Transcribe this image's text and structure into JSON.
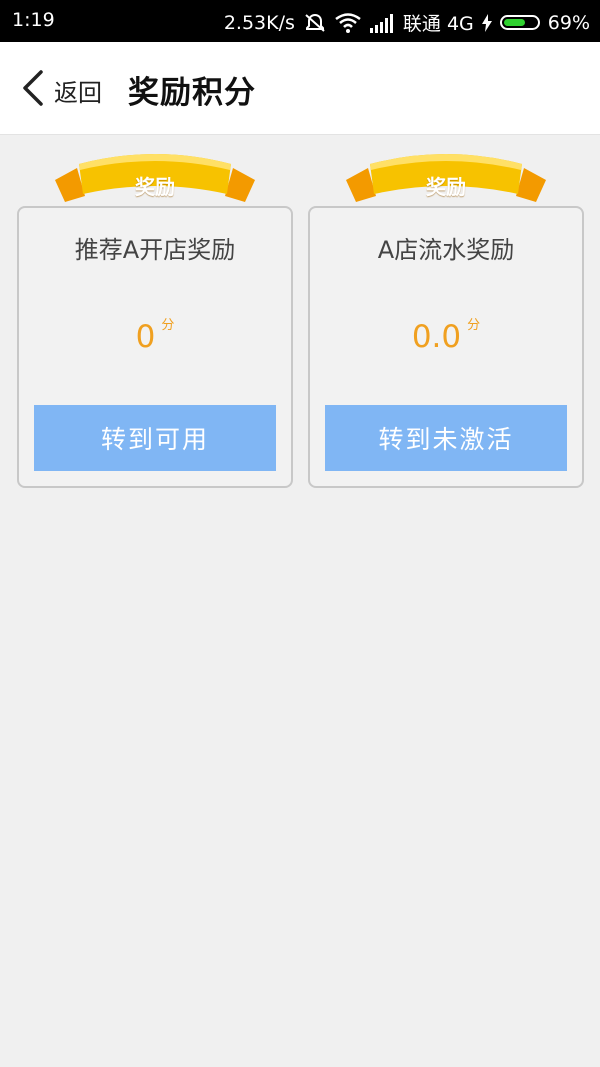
{
  "status_bar": {
    "time": "1:19",
    "network_speed": "2.53K/s",
    "carrier": "联通 4G",
    "battery": "69%",
    "icons": [
      "mute-vibrate-icon",
      "wifi-icon",
      "signal-icon",
      "charging-icon",
      "battery-icon"
    ],
    "battery_level": 0.69
  },
  "header": {
    "back_label": "返回",
    "title": "奖励积分",
    "back_icon": "chevron-left-icon"
  },
  "cards": [
    {
      "ribbon_label": "奖励",
      "title": "推荐A开店奖励",
      "points": "0",
      "unit": "分",
      "button_label": "转到可用"
    },
    {
      "ribbon_label": "奖励",
      "title": "A店流水奖励",
      "points": "0.0",
      "unit": "分",
      "button_label": "转到未激活"
    }
  ],
  "colors": {
    "accent_button": "#80b6f4",
    "points": "#f0a020",
    "ribbon": "#f5b800",
    "background": "#f0f0f0"
  }
}
